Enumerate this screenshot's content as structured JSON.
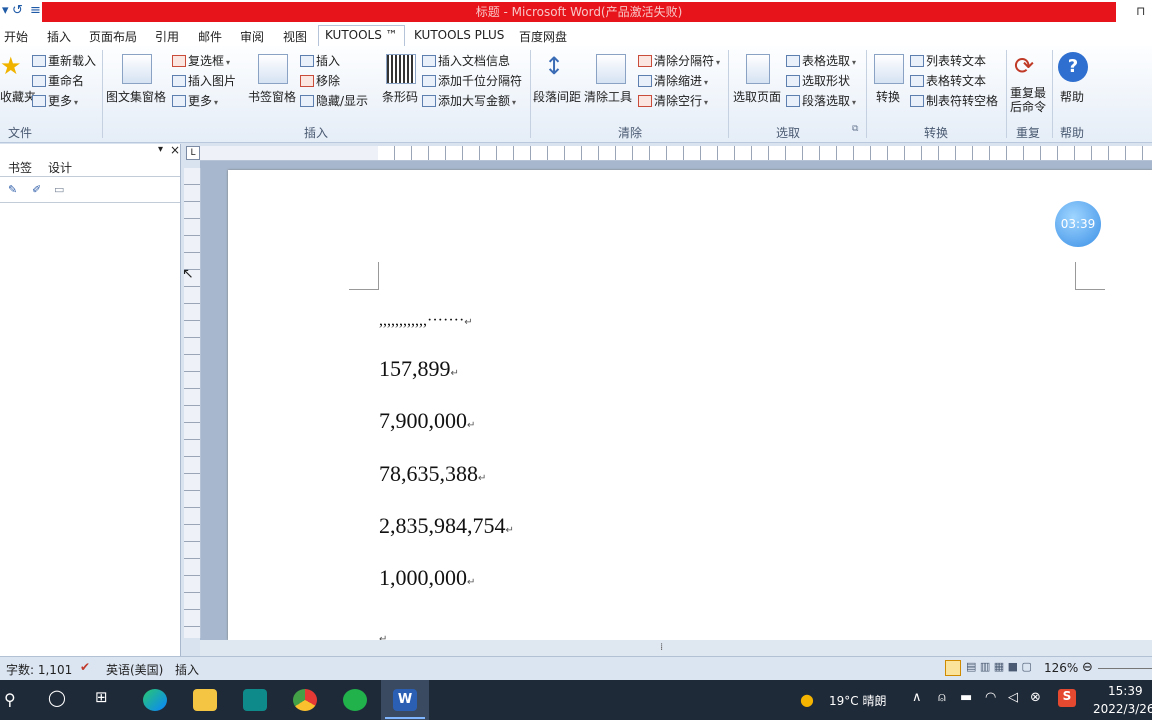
{
  "window": {
    "title": "标题 - Microsoft Word(产品激活失败)",
    "restore_glyph": "⊓"
  },
  "tabs": [
    "开始",
    "插入",
    "页面布局",
    "引用",
    "邮件",
    "审阅",
    "视图",
    "KUTOOLS ™",
    "KUTOOLS PLUS",
    "百度网盘"
  ],
  "ribbon": {
    "group_labels": {
      "file": "文件",
      "insert": "插入",
      "clear": "清除",
      "select": "选取",
      "convert": "转换",
      "repeat": "重复",
      "help": "帮助"
    },
    "file_group": {
      "big": "收藏夹",
      "items": [
        "重新载入",
        "重命名",
        "更多"
      ]
    },
    "insert_group": {
      "picture_table": "图文集窗格",
      "checkbox": "复选框",
      "insert_picture": "插入图片",
      "more": "更多",
      "bookmark_pane": "书签窗格",
      "insert": "插入",
      "remove": "移除",
      "hide_show": "隐藏/显示",
      "barcode": "条形码",
      "insert_doc_info": "插入文档信息",
      "add_thousand_sep": "添加千位分隔符",
      "add_amount_caps": "添加大写金额"
    },
    "clear_group": {
      "paragraph_spacing": "段落间距",
      "clear_tools": "清除工具",
      "clear_separator": "清除分隔符",
      "clear_indent": "清除缩进",
      "clear_space": "清除空行"
    },
    "select_group": {
      "select_page": "选取页面",
      "table_select": "表格选取",
      "select_shape": "选取形状",
      "paragraph_select": "段落选取"
    },
    "convert_group": {
      "convert": "转换",
      "list_to_text": "列表转文本",
      "table_to_text": "表格转文本",
      "tab_to_space": "制表符转空格"
    },
    "repeat_group": {
      "label": "重复最后命令"
    },
    "help_group": {
      "label": "帮助"
    }
  },
  "pane": {
    "tabs": [
      "书签",
      "设计"
    ],
    "close": "×",
    "pin": "▾"
  },
  "document": {
    "lines": [
      ",,,,,,,,,,,,·······",
      "157,899",
      "7,900,000",
      "78,635,388",
      "2,835,984,754",
      "1,000,000"
    ],
    "mark": "↵"
  },
  "timer": "03:39",
  "status": {
    "word_count": "字数: 1,101",
    "language": "英语(美国)",
    "mode": "插入",
    "zoom": "126%"
  },
  "taskbar": {
    "weather": "19°C 晴朗",
    "time": "15:39",
    "date": "2022/3/26"
  },
  "colors": {
    "titlebar_red": "#e8141b",
    "ribbon_bg": "#e5edf7",
    "doc_bg": "#a7b7cd",
    "taskbar": "#1f2a38"
  }
}
